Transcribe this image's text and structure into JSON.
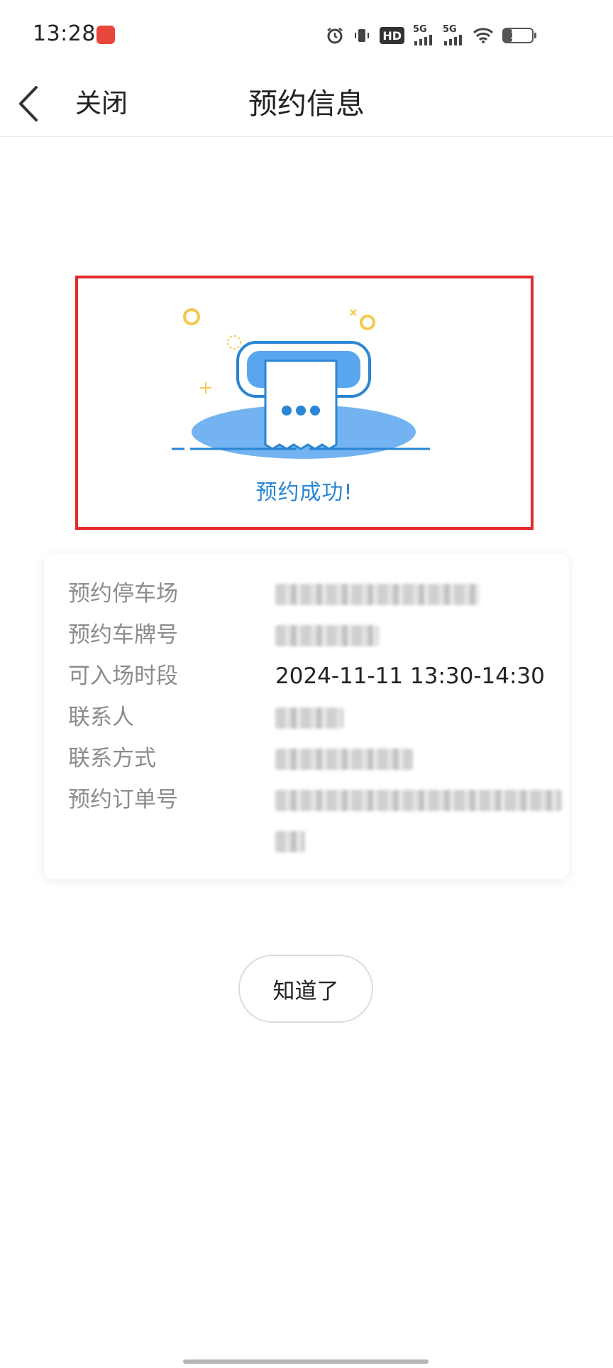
{
  "status_bar": {
    "time": "13:28",
    "hd_label": "HD",
    "net1": "5G",
    "net2": "5G",
    "battery_level": "30",
    "battery_fraction": 0.3
  },
  "nav": {
    "close_label": "关闭",
    "title": "预约信息"
  },
  "success": {
    "message": "预约成功!"
  },
  "info": {
    "rows": [
      {
        "label": "预约停车场",
        "value": ""
      },
      {
        "label": "预约车牌号",
        "value": ""
      },
      {
        "label": "可入场时段",
        "value": "2024-11-11 13:30-14:30"
      },
      {
        "label": "联系人",
        "value": ""
      },
      {
        "label": "联系方式",
        "value": ""
      },
      {
        "label": "预约订单号",
        "value": ""
      }
    ]
  },
  "actions": {
    "ok_label": "知道了"
  },
  "colors": {
    "accent_blue": "#2a86d4",
    "highlight_red": "#e52a2a"
  }
}
